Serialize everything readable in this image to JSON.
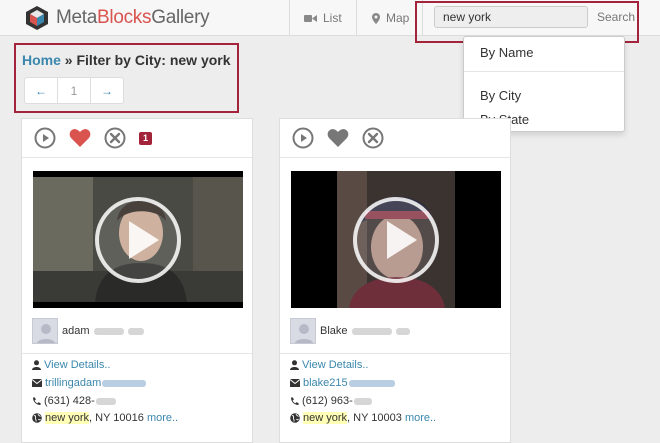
{
  "brand": {
    "part1": "Meta",
    "part2": "Blocks",
    "part3": "Gallery"
  },
  "nav": {
    "list_label": "List",
    "map_label": "Map"
  },
  "search": {
    "value": "new york",
    "button_label": "Search"
  },
  "dropdown": {
    "items": [
      "By Name",
      "By City",
      "By State"
    ]
  },
  "breadcrumb": {
    "home": "Home",
    "sep": " » ",
    "current": "Filter by City: new york"
  },
  "pager": {
    "prev": "←",
    "page": "1",
    "next": "→"
  },
  "cards": [
    {
      "badge": "1",
      "liked": true,
      "first_name": "adam",
      "details_label": "View Details..",
      "email_prefix": "trillingadam",
      "phone_prefix": "(631) 428-",
      "city_highlight": "new york",
      "address_rest": ", NY 10016",
      "more_label": "more.."
    },
    {
      "badge": "",
      "liked": false,
      "first_name": "Blake",
      "details_label": "View Details..",
      "email_prefix": "blake215",
      "phone_prefix": "(612) 963-",
      "city_highlight": "new york",
      "address_rest": ", NY 10003",
      "more_label": "more.."
    }
  ],
  "colors": {
    "accent_red": "#a3243a",
    "link_blue": "#3a87ad",
    "highlight": "#ffffb5",
    "heart_active": "#d9534f"
  },
  "icons": [
    "play-circle-icon",
    "heart-icon",
    "close-circle-icon",
    "user-icon",
    "envelope-icon",
    "phone-icon",
    "globe-icon",
    "video-camera-icon",
    "map-marker-icon"
  ]
}
